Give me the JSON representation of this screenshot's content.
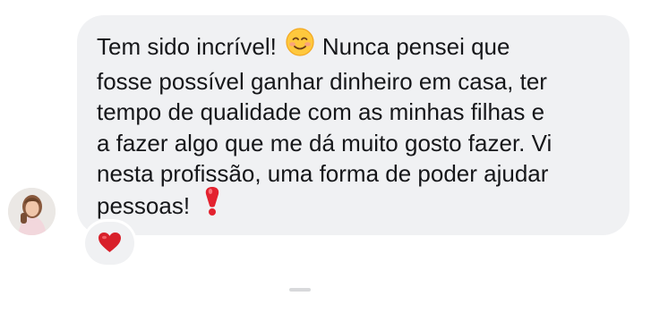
{
  "message": {
    "lines": [
      "Tem sido incrível!",
      "Nunca pensei que",
      "fosse possível ganhar dinheiro em casa, ter",
      "tempo de qualidade com as minhas filhas e",
      "a fazer algo que me dá muito gosto fazer. Vi",
      "nesta profissão, uma forma de poder ajudar",
      "pessoas!"
    ],
    "emojis": [
      "smiling-face-icon",
      "exclamation-mark-icon"
    ]
  },
  "reaction": {
    "icon": "heart-icon",
    "color": "#d8202a"
  },
  "colors": {
    "bubble": "#f0f1f3",
    "text": "#16171a"
  }
}
